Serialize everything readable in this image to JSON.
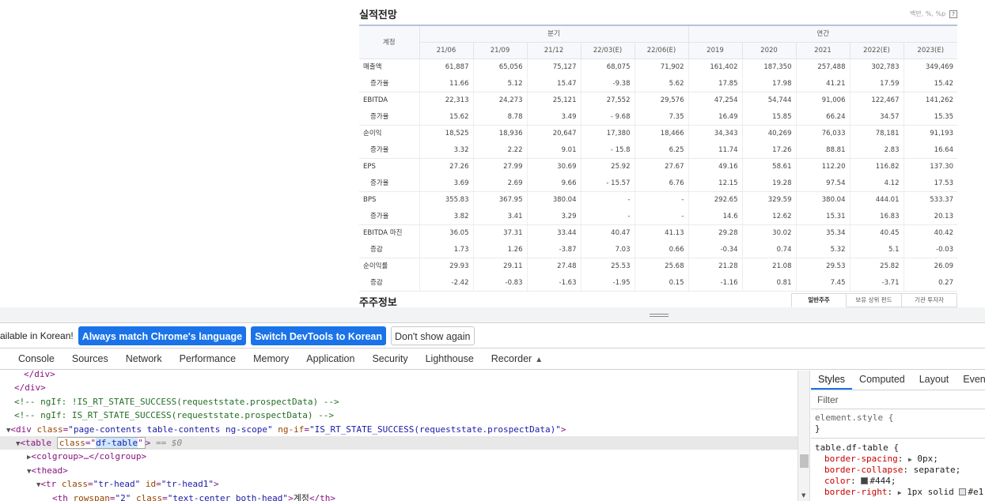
{
  "section": {
    "title": "실적전망",
    "unit_note": "백만, %, %p",
    "help": "?"
  },
  "table": {
    "account_header": "계정",
    "group_quarter": "분기",
    "group_annual": "연간",
    "periods": [
      "21/06",
      "21/09",
      "21/12",
      "22/03(E)",
      "22/06(E)",
      "2019",
      "2020",
      "2021",
      "2022(E)",
      "2023(E)"
    ],
    "rows": [
      {
        "label": "매출액",
        "sub": false,
        "values": [
          "61,887",
          "65,056",
          "75,127",
          "68,075",
          "71,902",
          "161,402",
          "187,350",
          "257,488",
          "302,783",
          "349,469"
        ],
        "signs": [
          "",
          "",
          "",
          "",
          "",
          "",
          "",
          "",
          "",
          ""
        ]
      },
      {
        "label": "증가율",
        "sub": true,
        "values": [
          "11.66",
          "5.12",
          "15.47",
          "-9.38",
          "5.62",
          "17.85",
          "17.98",
          "41.21",
          "17.59",
          "15.42"
        ],
        "signs": [
          "up",
          "up",
          "up",
          "down",
          "up",
          "up",
          "up",
          "up",
          "up",
          "up"
        ]
      },
      {
        "label": "EBITDA",
        "sub": false,
        "values": [
          "22,313",
          "24,273",
          "25,121",
          "27,552",
          "29,576",
          "47,254",
          "54,744",
          "91,006",
          "122,467",
          "141,262"
        ],
        "signs": [
          "",
          "",
          "",
          "",
          "",
          "",
          "",
          "",
          "",
          ""
        ]
      },
      {
        "label": "증가율",
        "sub": true,
        "values": [
          "15.62",
          "8.78",
          "3.49",
          "- 9.68",
          "7.35",
          "16.49",
          "15.85",
          "66.24",
          "34.57",
          "15.35"
        ],
        "signs": [
          "up",
          "up",
          "up",
          "down",
          "up",
          "up",
          "up",
          "up",
          "up",
          "up"
        ]
      },
      {
        "label": "순이익",
        "sub": false,
        "values": [
          "18,525",
          "18,936",
          "20,647",
          "17,380",
          "18,466",
          "34,343",
          "40,269",
          "76,033",
          "78,181",
          "91,193"
        ],
        "signs": [
          "",
          "",
          "",
          "",
          "",
          "",
          "",
          "",
          "",
          ""
        ]
      },
      {
        "label": "증가율",
        "sub": true,
        "values": [
          "3.32",
          "2.22",
          "9.01",
          "- 15.8",
          "6.25",
          "11.74",
          "17.26",
          "88.81",
          "2.83",
          "16.64"
        ],
        "signs": [
          "up",
          "up",
          "up",
          "down",
          "up",
          "up",
          "up",
          "up",
          "up",
          "up"
        ]
      },
      {
        "label": "EPS",
        "sub": false,
        "values": [
          "27.26",
          "27.99",
          "30.69",
          "25.92",
          "27.67",
          "49.16",
          "58.61",
          "112.20",
          "116.82",
          "137.30"
        ],
        "signs": [
          "",
          "",
          "",
          "",
          "",
          "",
          "",
          "",
          "",
          ""
        ]
      },
      {
        "label": "증가율",
        "sub": true,
        "values": [
          "3.69",
          "2.69",
          "9.66",
          "- 15.57",
          "6.76",
          "12.15",
          "19.28",
          "97.54",
          "4.12",
          "17.53"
        ],
        "signs": [
          "up",
          "up",
          "up",
          "down",
          "up",
          "up",
          "up",
          "up",
          "up",
          "up"
        ]
      },
      {
        "label": "BPS",
        "sub": false,
        "values": [
          "355.83",
          "367.95",
          "380.04",
          "-",
          "-",
          "292.65",
          "329.59",
          "380.04",
          "444.01",
          "533.37"
        ],
        "signs": [
          "",
          "",
          "",
          "",
          "",
          "",
          "",
          "",
          "",
          ""
        ]
      },
      {
        "label": "증가율",
        "sub": true,
        "values": [
          "3.82",
          "3.41",
          "3.29",
          "-",
          "-",
          "14.6",
          "12.62",
          "15.31",
          "16.83",
          "20.13"
        ],
        "signs": [
          "up",
          "up",
          "up",
          "up",
          "up",
          "up",
          "up",
          "up",
          "up",
          "up"
        ]
      },
      {
        "label": "EBITDA 마진",
        "sub": false,
        "values": [
          "36.05",
          "37.31",
          "33.44",
          "40.47",
          "41.13",
          "29.28",
          "30.02",
          "35.34",
          "40.45",
          "40.42"
        ],
        "signs": [
          "",
          "",
          "",
          "",
          "",
          "",
          "",
          "",
          "",
          ""
        ]
      },
      {
        "label": "증감",
        "sub": true,
        "values": [
          "1.73",
          "1.26",
          "-3.87",
          "7.03",
          "0.66",
          "-0.34",
          "0.74",
          "5.32",
          "5.1",
          "-0.03"
        ],
        "signs": [
          "up",
          "up",
          "down",
          "up",
          "up",
          "down",
          "up",
          "up",
          "up",
          "down"
        ]
      },
      {
        "label": "순이익률",
        "sub": false,
        "values": [
          "29.93",
          "29.11",
          "27.48",
          "25.53",
          "25.68",
          "21.28",
          "21.08",
          "29.53",
          "25.82",
          "26.09"
        ],
        "signs": [
          "",
          "",
          "",
          "",
          "",
          "",
          "",
          "",
          "",
          ""
        ]
      },
      {
        "label": "증감",
        "sub": true,
        "values": [
          "-2.42",
          "-0.83",
          "-1.63",
          "-1.95",
          "0.15",
          "-1.16",
          "0.81",
          "7.45",
          "-3.71",
          "0.27"
        ],
        "signs": [
          "down",
          "down",
          "down",
          "down",
          "up",
          "down",
          "up",
          "up",
          "down",
          "up"
        ]
      }
    ]
  },
  "shareholder": {
    "title": "주주정보",
    "tabs": [
      "일반주주",
      "보유 상위 펀드",
      "기관 투자자"
    ]
  },
  "devtools": {
    "lang_message": "ailable in Korean!",
    "btn_match": "Always match Chrome's language",
    "btn_switch": "Switch DevTools to Korean",
    "btn_dismiss": "Don't show again",
    "tabs": [
      "Console",
      "Sources",
      "Network",
      "Performance",
      "Memory",
      "Application",
      "Security",
      "Lighthouse",
      "Recorder"
    ],
    "styles_tabs": [
      "Styles",
      "Computed",
      "Layout",
      "Event"
    ],
    "filter_placeholder": "Filter",
    "dom": {
      "l1": "</div>",
      "l2": "</div>",
      "l3": "<!-- ngIf: !IS_RT_STATE_SUCCESS(requeststate.prospectData) -->",
      "l4": "<!-- ngIf: IS_RT_STATE_SUCCESS(requeststate.prospectData) -->",
      "l5_tag": "<div ",
      "l5_a1": "class",
      "l5_v1": "\"page-contents table-contents ng-scope\"",
      "l5_a2": "ng-if",
      "l5_v2": "\"IS_RT_STATE_SUCCESS(requeststate.prospectData)\"",
      "l6_tag": "<table ",
      "l6_attr": "class",
      "l6_eq": "=\"",
      "l6_val": "df-table",
      "l6_end": "\">",
      "l6_dollar": "== $0",
      "l7": "<colgroup>…</colgroup>",
      "l8": "<thead>",
      "l9_tag": "<tr ",
      "l9_a1": "class",
      "l9_v1": "\"tr-head\"",
      "l9_a2": "id",
      "l9_v2": "\"tr-head1\"",
      "l10_tag": "<th ",
      "l10_a1": "rowspan",
      "l10_v1": "\"2\"",
      "l10_a2": "class",
      "l10_v2": "\"text-center both-head\"",
      "l10_text": "계정",
      "l10_close": "</th>"
    },
    "css": {
      "element_style": "element.style {",
      "close": "}",
      "selector": "table.df-table {",
      "p1_name": "border-spacing",
      "p1_val": "0px;",
      "p2_name": "border-collapse",
      "p2_val": "separate;",
      "p3_name": "color",
      "p3_val": "#444;",
      "p4_name": "border-right",
      "p4_val": "1px solid",
      "p4_color": "#e1"
    },
    "swatch_dark": "#444444",
    "swatch_light": "#e1e4ea"
  }
}
